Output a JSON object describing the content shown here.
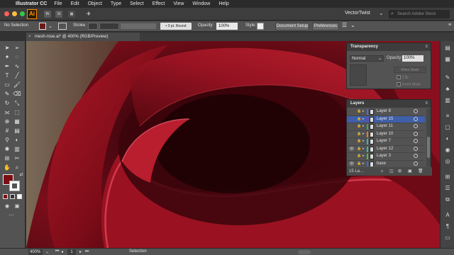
{
  "menubar": {
    "apple": "",
    "app_name": "Illustrator CC",
    "items": [
      "File",
      "Edit",
      "Object",
      "Type",
      "Select",
      "Effect",
      "View",
      "Window",
      "Help"
    ]
  },
  "appbar": {
    "logo": "Ai",
    "icon_br": "Br",
    "icon_st": "St",
    "workspace": "VectorTwist",
    "search_placeholder": "Search Adobe Stock"
  },
  "control": {
    "selection": "No Selection",
    "stroke_label": "Stroke",
    "profile": "3 pt. Round",
    "opacity_label": "Opacity:",
    "opacity_value": "100%",
    "style_label": "Style:",
    "doc_setup": "Document Setup",
    "preferences": "Preferences",
    "fill_color": "#6b1a1a"
  },
  "document": {
    "tab_title": "mesh-rose.ai* @ 400% (RGB/Preview)",
    "close_glyph": "×"
  },
  "transparency": {
    "title": "Transparency",
    "blend_mode": "Normal",
    "opacity_label": "Opacity:",
    "opacity_value": "100%",
    "make_mask": "Make Mask",
    "clip": "Clip",
    "invert_mask": "Invert Mask"
  },
  "layers": {
    "title": "Layers",
    "rows": [
      {
        "name": "Layer 8",
        "color": "#4a6cff",
        "visible": false,
        "selected": false
      },
      {
        "name": "Layer 15",
        "color": "#9a2bd6",
        "visible": false,
        "selected": true
      },
      {
        "name": "Layer 11",
        "color": "#26b45a",
        "visible": false,
        "selected": false
      },
      {
        "name": "Layer 10",
        "color": "#ff7a1a",
        "visible": false,
        "selected": false
      },
      {
        "name": "Layer 7",
        "color": "#26c0c0",
        "visible": false,
        "selected": false
      },
      {
        "name": "Layer 12",
        "color": "#26c0c0",
        "visible": true,
        "selected": false
      },
      {
        "name": "Layer 3",
        "color": "#2ecc40",
        "visible": false,
        "selected": false
      },
      {
        "name": "base",
        "color": "#2f6bff",
        "visible": true,
        "selected": false
      }
    ],
    "count": "15 La...",
    "eye_glyph": "👁",
    "lock_glyph": "🔒"
  },
  "status": {
    "zoom": "400%",
    "page": "1",
    "mode": "Selection"
  },
  "colors": {
    "rose_dark": "#3a0408",
    "rose_mid": "#8c0f1c",
    "rose_light": "#d02a3a",
    "accent_selected": "#3f5fa8"
  }
}
